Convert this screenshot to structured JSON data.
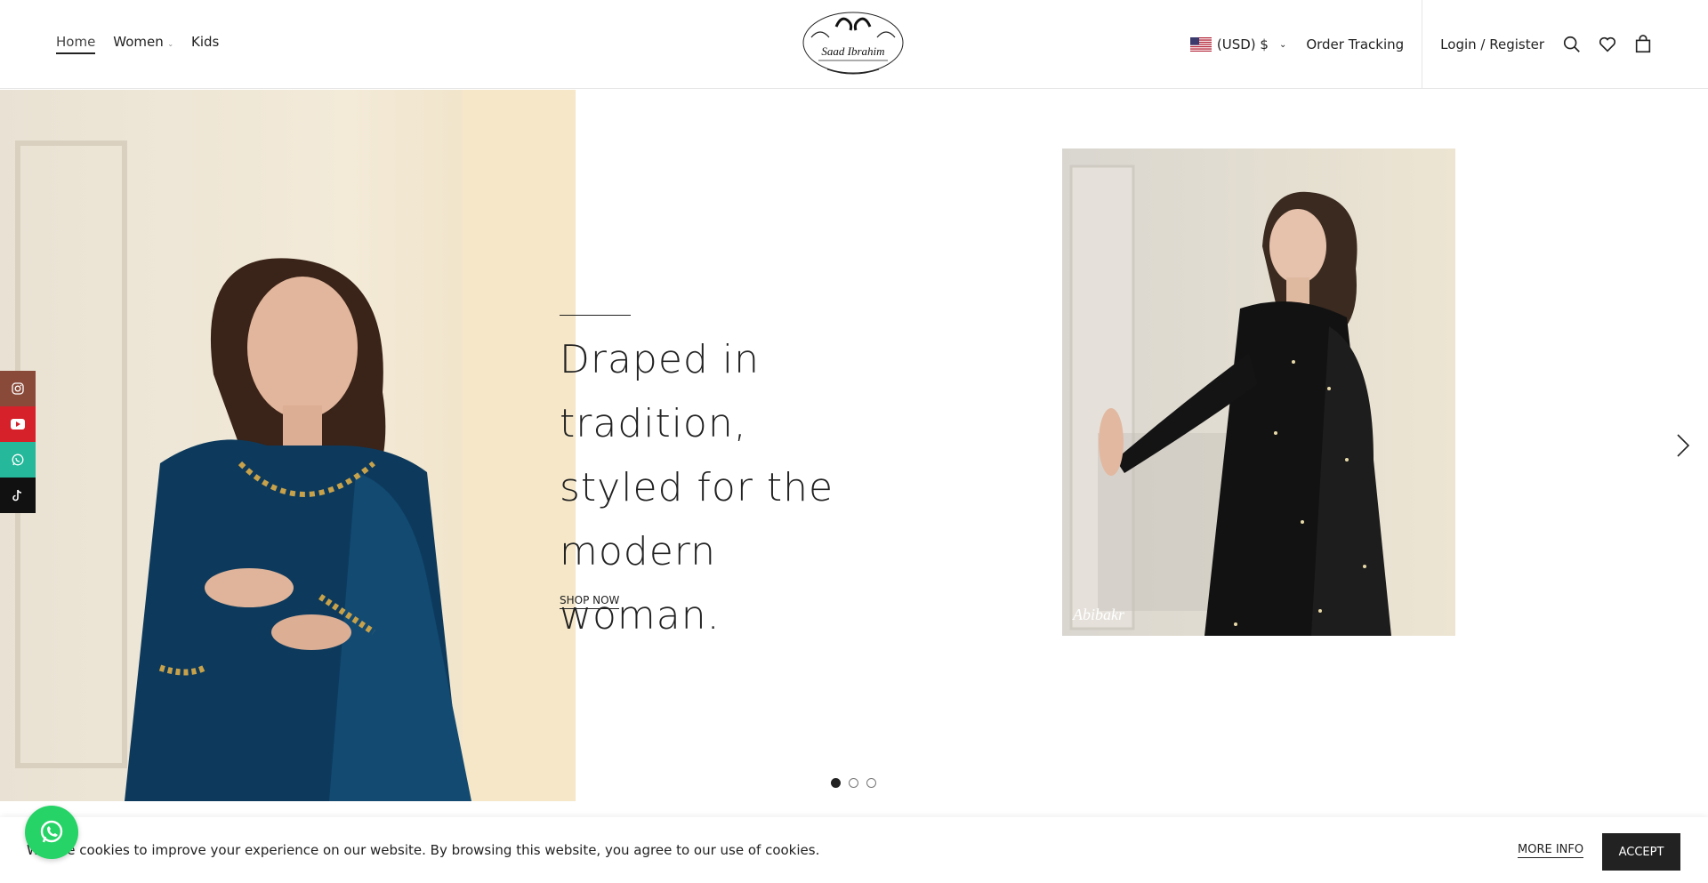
{
  "nav": {
    "items": [
      {
        "label": "Home",
        "active": true
      },
      {
        "label": "Women",
        "has_dropdown": true
      },
      {
        "label": "Kids"
      }
    ]
  },
  "header": {
    "logo_icon": "saad-ibrahim-logo",
    "currency": "(USD) $",
    "order_tracking": "Order Tracking",
    "login": "Login / Register",
    "icons": [
      "search-icon",
      "wishlist-heart-icon",
      "cart-bag-icon"
    ]
  },
  "hero": {
    "heading": "Draped in tradition, styled for the modern woman.",
    "cta": "SHOP NOW",
    "slides_total": 3,
    "active_slide": 1
  },
  "social": [
    "instagram-icon",
    "youtube-icon",
    "whatsapp-icon",
    "tiktok-icon"
  ],
  "cookie": {
    "text": "We use cookies to improve your experience on our website. By browsing this website, you agree to our use of cookies.",
    "more_info": "MORE INFO",
    "accept": "ACCEPT"
  },
  "colors": {
    "primary": "#222222",
    "whatsapp": "#25d366"
  }
}
